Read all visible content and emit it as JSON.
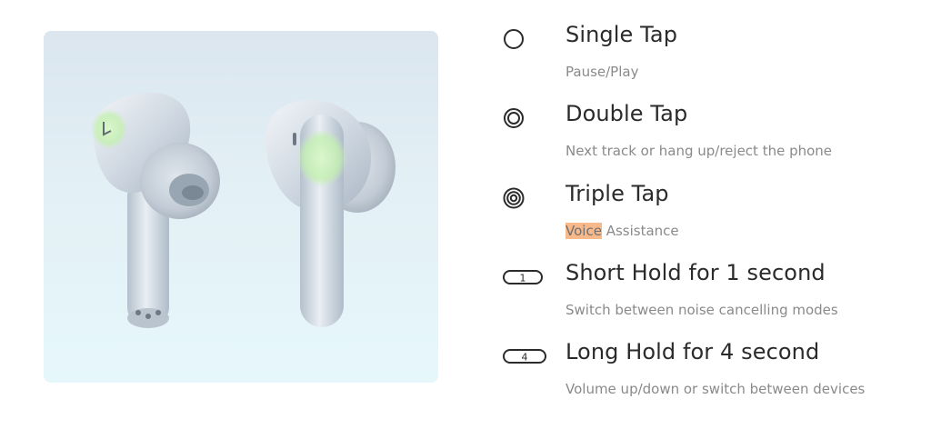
{
  "image": {
    "alt": "earbuds-product-image"
  },
  "controls": [
    {
      "icon": "single-tap-icon",
      "title": "Single Tap",
      "desc_prefix": "",
      "desc_highlight": "",
      "desc_rest": "Pause/Play"
    },
    {
      "icon": "double-tap-icon",
      "title": "Double Tap",
      "desc_prefix": "",
      "desc_highlight": "",
      "desc_rest": "Next track or hang up/reject the phone"
    },
    {
      "icon": "triple-tap-icon",
      "title": "Triple Tap",
      "desc_prefix": "",
      "desc_highlight": "Voice",
      "desc_rest": " Assistance"
    },
    {
      "icon": "hold-1-icon",
      "icon_label": "1",
      "title": "Short Hold for 1 second",
      "desc_prefix": "",
      "desc_highlight": "",
      "desc_rest": "Switch between noise cancelling modes"
    },
    {
      "icon": "hold-4-icon",
      "icon_label": "4",
      "title": "Long Hold for 4 second",
      "desc_prefix": "",
      "desc_highlight": "",
      "desc_rest": "Volume up/down or switch between devices"
    }
  ],
  "colors": {
    "text_primary": "#2b2b2b",
    "text_secondary": "#8a8a8a",
    "highlight": "#f8b98a"
  }
}
